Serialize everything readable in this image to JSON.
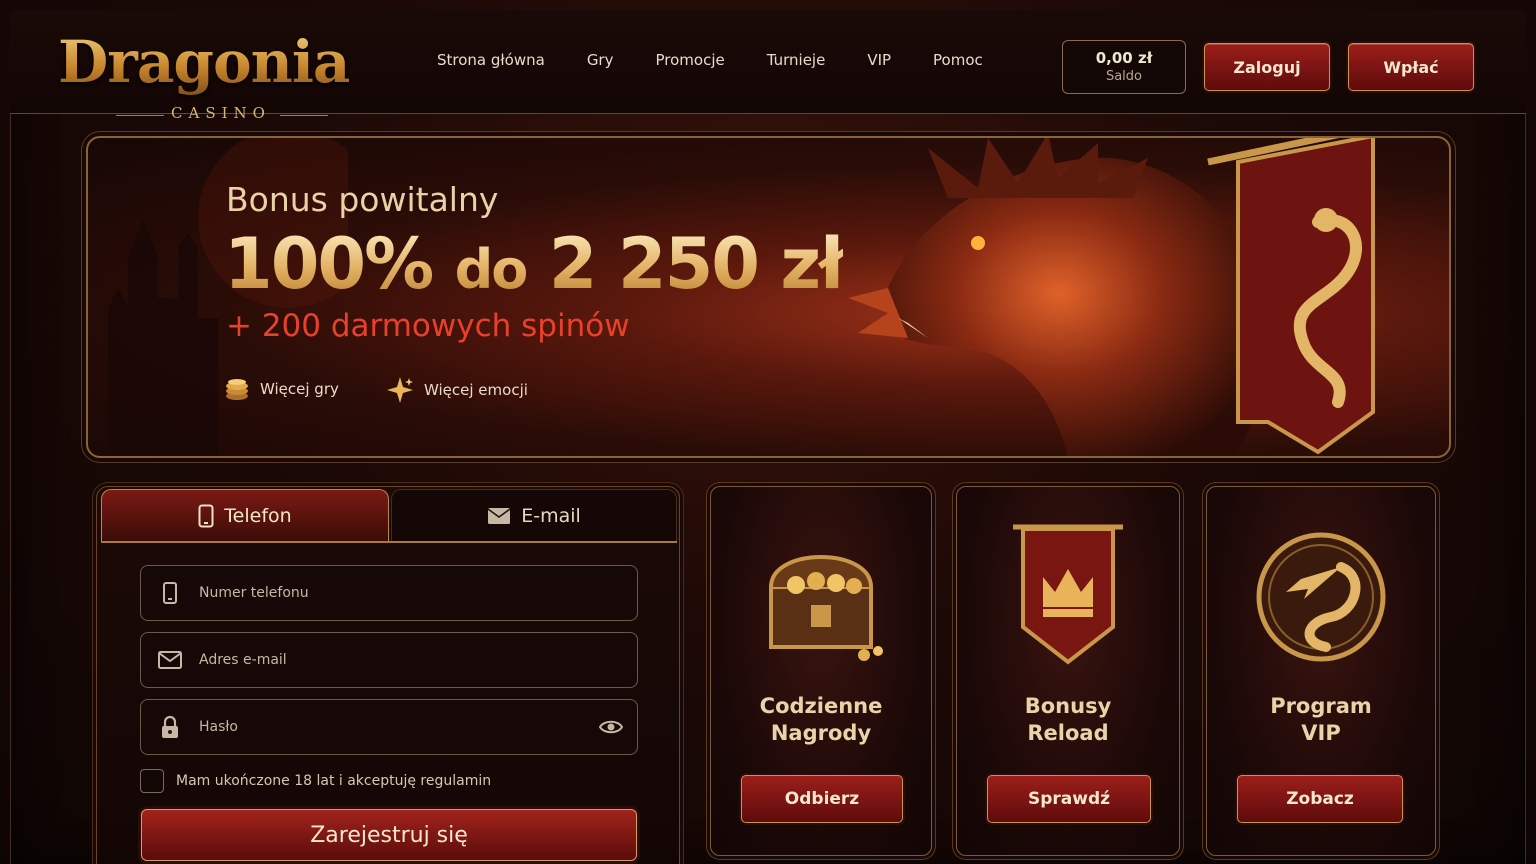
{
  "brand": {
    "name": "Dragonia",
    "sub": "CASINO"
  },
  "nav": {
    "items": [
      "Strona główna",
      "Gry",
      "Promocje",
      "Turnieje",
      "VIP",
      "Pomoc"
    ]
  },
  "balance": {
    "amount": "0,00 zł",
    "label": "Saldo"
  },
  "header_buttons": {
    "login": "Zaloguj",
    "deposit": "Wpłać"
  },
  "hero": {
    "title": "Bonus powitalny",
    "big_percent": "100%",
    "big_mid": "do",
    "big_amount": "2 250 zł",
    "spins": "+ 200 darmowych spinów",
    "features": [
      {
        "icon": "coins-icon",
        "label": "Więcej gry"
      },
      {
        "icon": "sparkle-icon",
        "label": "Więcej emocji"
      }
    ]
  },
  "form": {
    "tabs": [
      {
        "icon": "phone-icon",
        "label": "Telefon",
        "active": true
      },
      {
        "icon": "envelope-icon",
        "label": "E-mail",
        "active": false
      }
    ],
    "fields": {
      "phone": {
        "placeholder": "Numer telefonu",
        "value": ""
      },
      "email": {
        "placeholder": "Adres e-mail",
        "value": ""
      },
      "password": {
        "placeholder": "Hasło",
        "value": ""
      }
    },
    "consent": "Mam ukończone 18 lat i akceptuję regulamin",
    "submit": "Zarejestruj się"
  },
  "cards": [
    {
      "title_line1": "Codzienne",
      "title_line2": "Nagrody",
      "button": "Odbierz",
      "icon": "treasure-chest-icon"
    },
    {
      "title_line1": "Bonusy",
      "title_line2": "Reload",
      "button": "Sprawdź",
      "icon": "crown-banner-icon"
    },
    {
      "title_line1": "Program",
      "title_line2": "VIP",
      "button": "Zobacz",
      "icon": "dragon-medallion-icon"
    }
  ],
  "colors": {
    "accent_red": "#9c1e1a",
    "gold": "#d9a55a",
    "background": "#140806"
  }
}
